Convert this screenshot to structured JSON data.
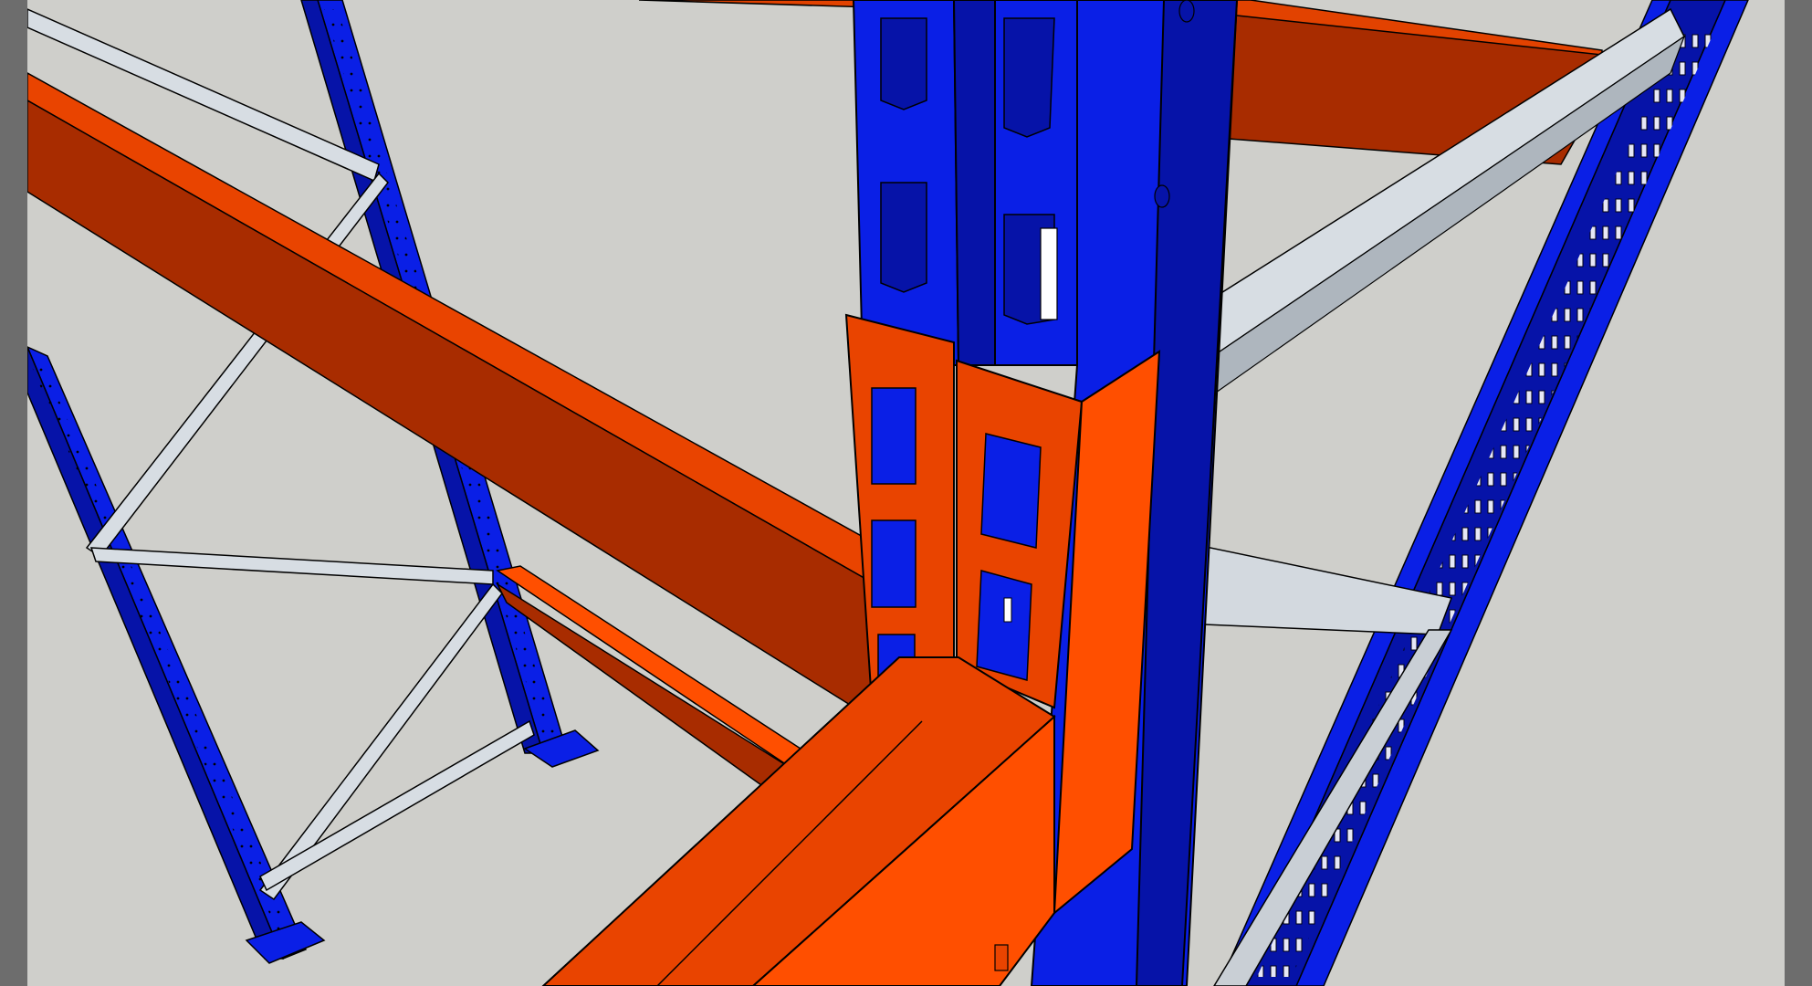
{
  "app": {
    "type": "3d-modeling-viewport"
  },
  "scene": {
    "subject": "pallet-racking-upright-and-beam-connection",
    "colors": {
      "background": "#cfcfcb",
      "side_panel": "#6d6d6d",
      "upright_blue": "#0a1fe6",
      "upright_blue_dark": "#0613a8",
      "beam_orange_light": "#ff4f00",
      "beam_orange": "#e94400",
      "beam_orange_dark": "#a82c00",
      "bracing_steel": "#d7dde3",
      "bracing_steel_dark": "#a9b2bb",
      "edge": "#000000"
    }
  }
}
